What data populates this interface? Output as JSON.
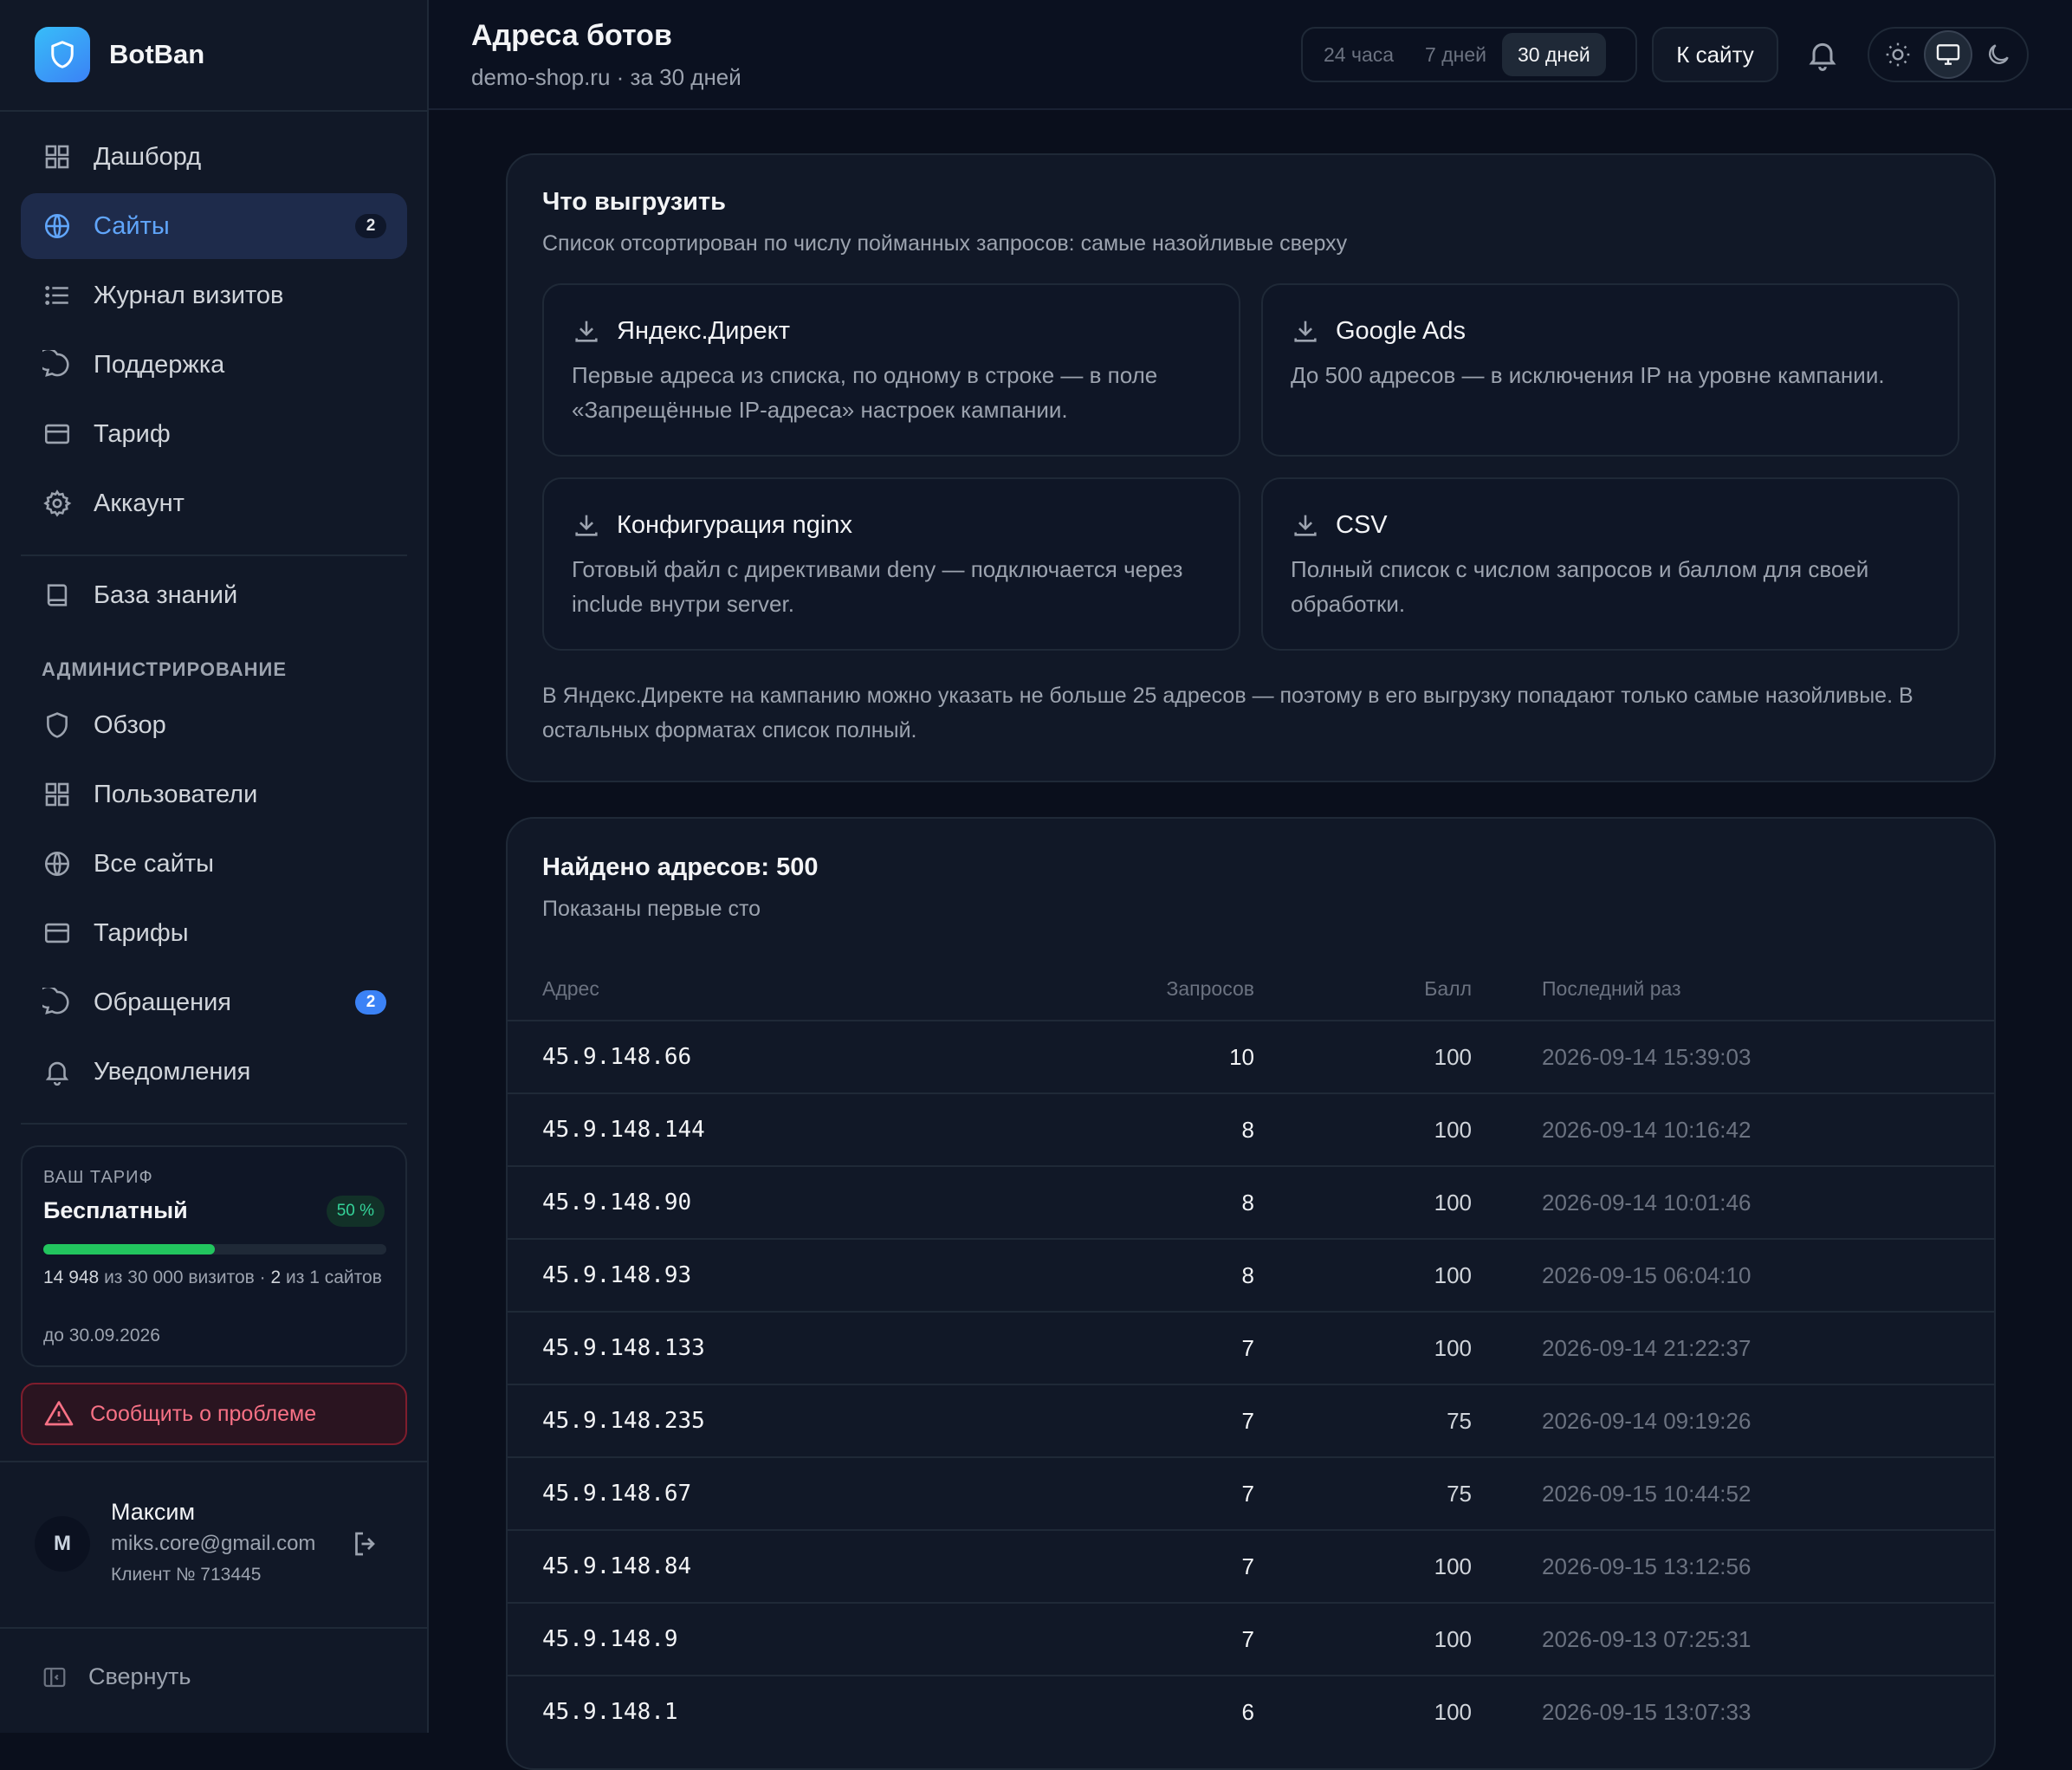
{
  "brand": {
    "name": "BotBan"
  },
  "nav": [
    {
      "label": "Дашборд",
      "icon": "grid-icon",
      "active": false
    },
    {
      "label": "Сайты",
      "icon": "globe-icon",
      "active": true,
      "badge": "2"
    },
    {
      "label": "Журнал визитов",
      "icon": "list-icon",
      "active": false
    },
    {
      "label": "Поддержка",
      "icon": "chat-icon",
      "active": false
    },
    {
      "label": "Тариф",
      "icon": "card-icon",
      "active": false
    },
    {
      "label": "Аккаунт",
      "icon": "gear-icon",
      "active": false
    }
  ],
  "knowledge": {
    "label": "База знаний",
    "icon": "book-icon"
  },
  "admin": {
    "section_label": "АДМИНИСТРИРОВАНИЕ",
    "items": [
      {
        "label": "Обзор",
        "icon": "shield-icon"
      },
      {
        "label": "Пользователи",
        "icon": "grid-icon"
      },
      {
        "label": "Все сайты",
        "icon": "globe-icon"
      },
      {
        "label": "Тарифы",
        "icon": "card-icon"
      },
      {
        "label": "Обращения",
        "icon": "chat-icon",
        "badge": "2"
      },
      {
        "label": "Уведомления",
        "icon": "bell-icon"
      }
    ]
  },
  "plan": {
    "label": "ВАШ ТАРИФ",
    "name": "Бесплатный",
    "percent_label": "50 %",
    "progress_fraction": 0.5,
    "visits_used": "14 948",
    "visits_text": "из 30 000 визитов ·",
    "sites_used": "2",
    "sites_text": "из 1 сайтов",
    "until": "до 30.09.2026"
  },
  "report_button": "Сообщить о проблеме",
  "user": {
    "initial": "М",
    "name": "Максим",
    "email": "miks.core@gmail.com",
    "client_id": "Клиент № 713445"
  },
  "collapse_label": "Свернуть",
  "header": {
    "title": "Адреса ботов",
    "subtitle": "demo-shop.ru · за 30 дней",
    "ranges": [
      "24 часа",
      "7 дней",
      "30 дней"
    ],
    "active_range": "30 дней",
    "site_button": "К сайту"
  },
  "export": {
    "title": "Что выгрузить",
    "subtitle": "Список отсортирован по числу пойманных запросов: самые назойливые сверху",
    "formats": [
      {
        "name": "Яндекс.Директ",
        "desc": "Первые адреса из списка, по одному в строке — в поле «Запрещённые IP-адреса» настроек кампании."
      },
      {
        "name": "Google Ads",
        "desc": "До 500 адресов — в исключения IP на уровне кампании."
      },
      {
        "name": "Конфигурация nginx",
        "desc": "Готовый файл с директивами deny — подключается через include внутри server."
      },
      {
        "name": "CSV",
        "desc": "Полный список с числом запросов и баллом для своей обработки."
      }
    ],
    "note": "В Яндекс.Директе на кампанию можно указать не больше 25 адресов — поэтому в его выгрузку попадают только самые назойливые. В остальных форматах список полный."
  },
  "results": {
    "title": "Найдено адресов: 500",
    "subtitle": "Показаны первые сто",
    "columns": [
      "Адрес",
      "Запросов",
      "Балл",
      "Последний раз"
    ],
    "rows": [
      {
        "ip": "45.9.148.66",
        "requests": "10",
        "score": "100",
        "last": "2026-09-14 15:39:03"
      },
      {
        "ip": "45.9.148.144",
        "requests": "8",
        "score": "100",
        "last": "2026-09-14 10:16:42"
      },
      {
        "ip": "45.9.148.90",
        "requests": "8",
        "score": "100",
        "last": "2026-09-14 10:01:46"
      },
      {
        "ip": "45.9.148.93",
        "requests": "8",
        "score": "100",
        "last": "2026-09-15 06:04:10"
      },
      {
        "ip": "45.9.148.133",
        "requests": "7",
        "score": "100",
        "last": "2026-09-14 21:22:37"
      },
      {
        "ip": "45.9.148.235",
        "requests": "7",
        "score": "75",
        "last": "2026-09-14 09:19:26"
      },
      {
        "ip": "45.9.148.67",
        "requests": "7",
        "score": "75",
        "last": "2026-09-15 10:44:52"
      },
      {
        "ip": "45.9.148.84",
        "requests": "7",
        "score": "100",
        "last": "2026-09-15 13:12:56"
      },
      {
        "ip": "45.9.148.9",
        "requests": "7",
        "score": "100",
        "last": "2026-09-13 07:25:31"
      },
      {
        "ip": "45.9.148.1",
        "requests": "6",
        "score": "100",
        "last": "2026-09-15 13:07:33"
      }
    ]
  },
  "colors": {
    "accent": "#3b82f6",
    "success": "#22c55e",
    "danger": "#f87185",
    "background": "#0a0f1c"
  }
}
